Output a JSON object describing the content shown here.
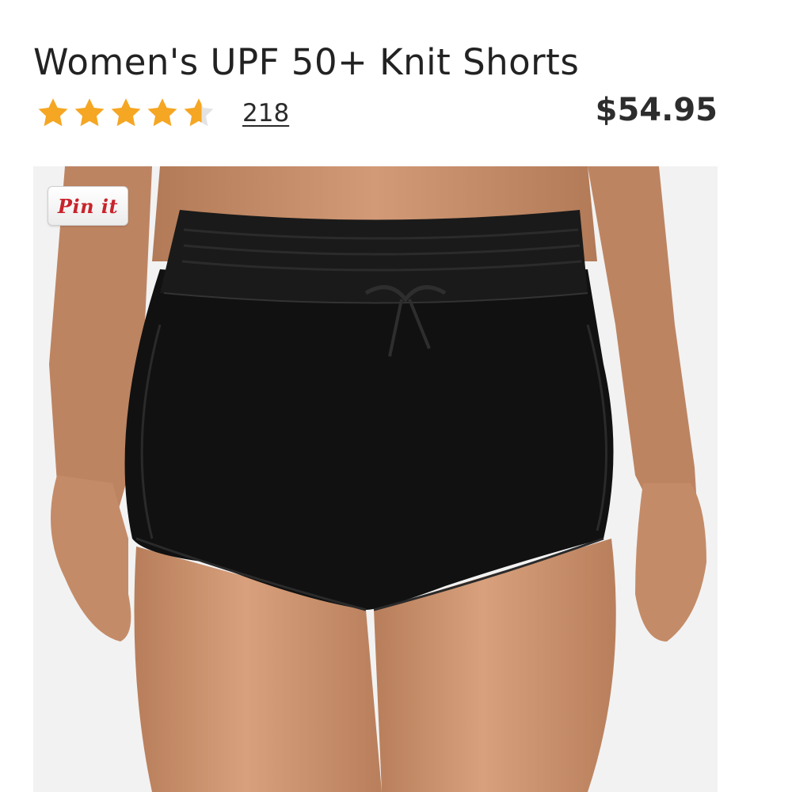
{
  "product": {
    "title": "Women's UPF 50+ Knit Shorts",
    "price": "$54.95"
  },
  "rating": {
    "value_out_of_5": 4.6,
    "review_count": "218",
    "star_color": "#f5a623",
    "empty_star_color": "#e3e3e3"
  },
  "pin_button": {
    "label": "Pin it",
    "color": "#c8232c"
  },
  "image": {
    "subject": "black shorts",
    "shorts_color": "#111111",
    "skin_color": "#c98e6b",
    "background_color": "#f2f2f2"
  }
}
